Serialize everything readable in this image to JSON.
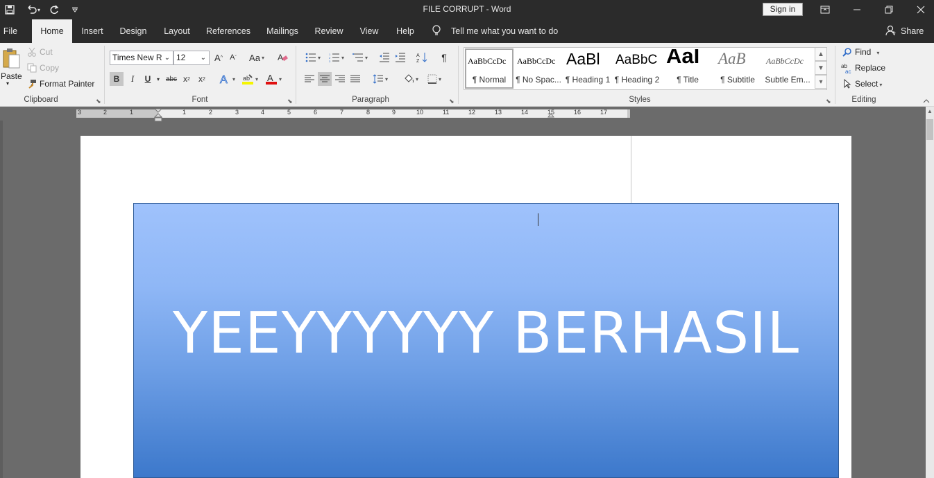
{
  "titlebar": {
    "title": "FILE CORRUPT  -  Word",
    "sign_in": "Sign in"
  },
  "tabs": [
    "File",
    "Home",
    "Insert",
    "Design",
    "Layout",
    "References",
    "Mailings",
    "Review",
    "View",
    "Help"
  ],
  "tell_me": "Tell me what you want to do",
  "share": "Share",
  "clipboard": {
    "paste": "Paste",
    "cut": "Cut",
    "copy": "Copy",
    "format_painter": "Format Painter",
    "group": "Clipboard"
  },
  "font": {
    "family": "Times New R",
    "size": "12",
    "group": "Font"
  },
  "paragraph": {
    "group": "Paragraph"
  },
  "styles": {
    "group": "Styles",
    "items": [
      {
        "preview": "AaBbCcDc",
        "label": "¶ Normal"
      },
      {
        "preview": "AaBbCcDc",
        "label": "¶ No Spac..."
      },
      {
        "preview": "AaBl",
        "label": "¶ Heading 1"
      },
      {
        "preview": "AaBbC",
        "label": "¶ Heading 2"
      },
      {
        "preview": "AaI",
        "label": "¶ Title"
      },
      {
        "preview": "AaB",
        "label": "¶ Subtitle"
      },
      {
        "preview": "AaBbCcDc",
        "label": "Subtle Em..."
      }
    ]
  },
  "editing": {
    "group": "Editing",
    "find": "Find",
    "replace": "Replace",
    "select": "Select"
  },
  "ruler": [
    "3",
    "2",
    "1",
    "1",
    "2",
    "3",
    "4",
    "5",
    "6",
    "7",
    "8",
    "9",
    "10",
    "11",
    "12",
    "13",
    "14",
    "15",
    "16",
    "17"
  ],
  "document": {
    "banner_text": "YEEYYYYYY BERHASIL"
  }
}
